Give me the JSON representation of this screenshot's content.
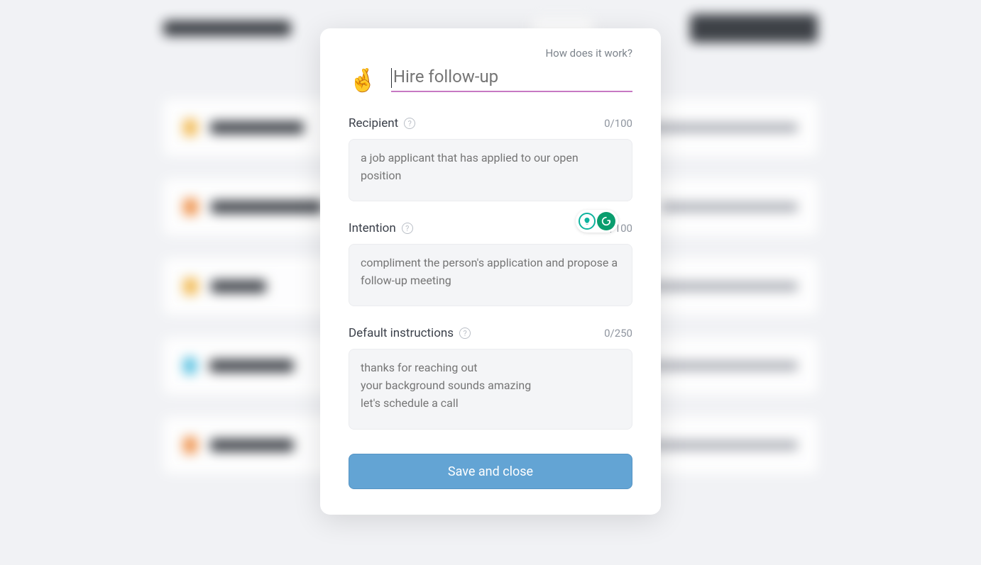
{
  "modal": {
    "help_link": "How does it work?",
    "emoji": "🤞",
    "title_placeholder": "Hire follow-up",
    "recipient": {
      "label": "Recipient",
      "counter": "0/100",
      "placeholder": "a job applicant that has applied to our open position"
    },
    "intention": {
      "label": "Intention",
      "counter": "0/100",
      "placeholder": "compliment the person's application and propose a follow-up meeting"
    },
    "instructions": {
      "label": "Default instructions",
      "counter": "0/250",
      "placeholder": "thanks for reaching out\nyour background sounds amazing\nlet's schedule a call"
    },
    "save_label": "Save and close"
  }
}
